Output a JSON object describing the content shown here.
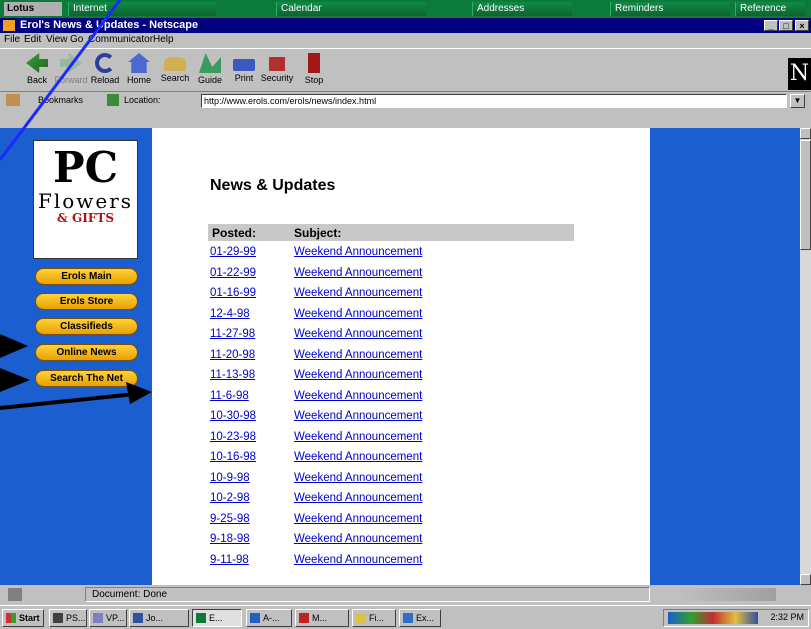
{
  "lotus_bar": {
    "logo": "Lotus",
    "tabs": [
      "Internet",
      "Calendar",
      "Addresses",
      "Reminders",
      "Reference"
    ]
  },
  "window": {
    "title": "Erol's News & Updates - Netscape",
    "controls": [
      "_",
      "□",
      "×"
    ]
  },
  "menu": [
    "File",
    "Edit",
    "View",
    "Go",
    "Communicator",
    "Help"
  ],
  "toolbar": {
    "buttons": [
      "Back",
      "Forward",
      "Reload",
      "Home",
      "Search",
      "Guide",
      "Print",
      "Security",
      "Stop"
    ]
  },
  "location_bar": {
    "bookmarks_label": "Bookmarks",
    "location_label": "Location:",
    "url": "http://www.erols.com/erols/news/index.html"
  },
  "sidebar": {
    "logo_pc": "PC",
    "logo_flowers": "Flowers",
    "logo_gifts": "& GIFTS",
    "nav": [
      "Erols Main",
      "Erols Store",
      "Classifieds",
      "Online News",
      "Search The Net"
    ]
  },
  "main": {
    "heading": "News & Updates",
    "col_posted": "Posted:",
    "col_subject": "Subject:",
    "rows": [
      {
        "date": "01-29-99",
        "subject": "Weekend Announcement"
      },
      {
        "date": "01-22-99",
        "subject": "Weekend Announcement"
      },
      {
        "date": "01-16-99",
        "subject": "Weekend Announcement"
      },
      {
        "date": "12-4-98",
        "subject": "Weekend Announcement"
      },
      {
        "date": "11-27-98",
        "subject": "Weekend Announcement"
      },
      {
        "date": "11-20-98",
        "subject": "Weekend Announcement"
      },
      {
        "date": "11-13-98",
        "subject": "Weekend Announcement"
      },
      {
        "date": "11-6-98",
        "subject": "Weekend Announcement"
      },
      {
        "date": "10-30-98",
        "subject": "Weekend Announcement"
      },
      {
        "date": "10-23-98",
        "subject": "Weekend Announcement"
      },
      {
        "date": "10-16-98",
        "subject": "Weekend Announcement"
      },
      {
        "date": "10-9-98",
        "subject": "Weekend Announcement"
      },
      {
        "date": "10-2-98",
        "subject": "Weekend Announcement"
      },
      {
        "date": "9-25-98",
        "subject": "Weekend Announcement"
      },
      {
        "date": "9-18-98",
        "subject": "Weekend Announcement"
      },
      {
        "date": "9-11-98",
        "subject": "Weekend Announcement"
      }
    ]
  },
  "status": {
    "text": "Document: Done"
  },
  "taskbar": {
    "start": "Start",
    "items": [
      "PS...",
      "VP...",
      "Jo...",
      "E...",
      "A-...",
      "M...",
      "Fi...",
      "Ex..."
    ],
    "clock": "2:32 PM"
  },
  "colors": {
    "page_blue": "#1a5ed0",
    "link": "#0000cc",
    "nav_button": "#f5b800",
    "title_bar": "#000080",
    "lotus_bar": "#0c7a3a"
  }
}
